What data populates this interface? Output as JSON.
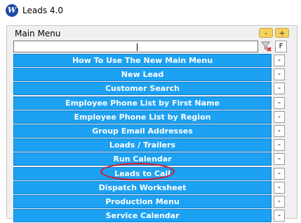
{
  "window": {
    "title": "Leads 4.0",
    "app_icon": "w-logo-icon"
  },
  "menu": {
    "title": "Main Menu",
    "collapse_label": "-",
    "expand_label": "+",
    "filter": {
      "value": "",
      "placeholder": "",
      "clear_icon": "clear-filter-icon",
      "f_label": "F"
    },
    "items": [
      {
        "label": "How To Use The New Main Menu",
        "remove_label": "-"
      },
      {
        "label": "New Lead",
        "remove_label": "-"
      },
      {
        "label": "Customer Search",
        "remove_label": "-"
      },
      {
        "label": "Employee Phone List by First Name",
        "remove_label": "-"
      },
      {
        "label": "Employee Phone List by Region",
        "remove_label": "-"
      },
      {
        "label": "Group Email Addresses",
        "remove_label": "-"
      },
      {
        "label": "Loads / Trailers",
        "remove_label": "-"
      },
      {
        "label": "Run Calendar",
        "remove_label": "-"
      },
      {
        "label": "Leads to Call",
        "remove_label": "-"
      },
      {
        "label": "Dispatch Worksheet",
        "remove_label": "-"
      },
      {
        "label": "Production Menu",
        "remove_label": "-"
      },
      {
        "label": "Service Calendar",
        "remove_label": "-"
      }
    ]
  },
  "colors": {
    "menu_item_bg": "#1da1f2",
    "small_button_bg": "#f6d15c",
    "highlight": "#e0101e"
  }
}
